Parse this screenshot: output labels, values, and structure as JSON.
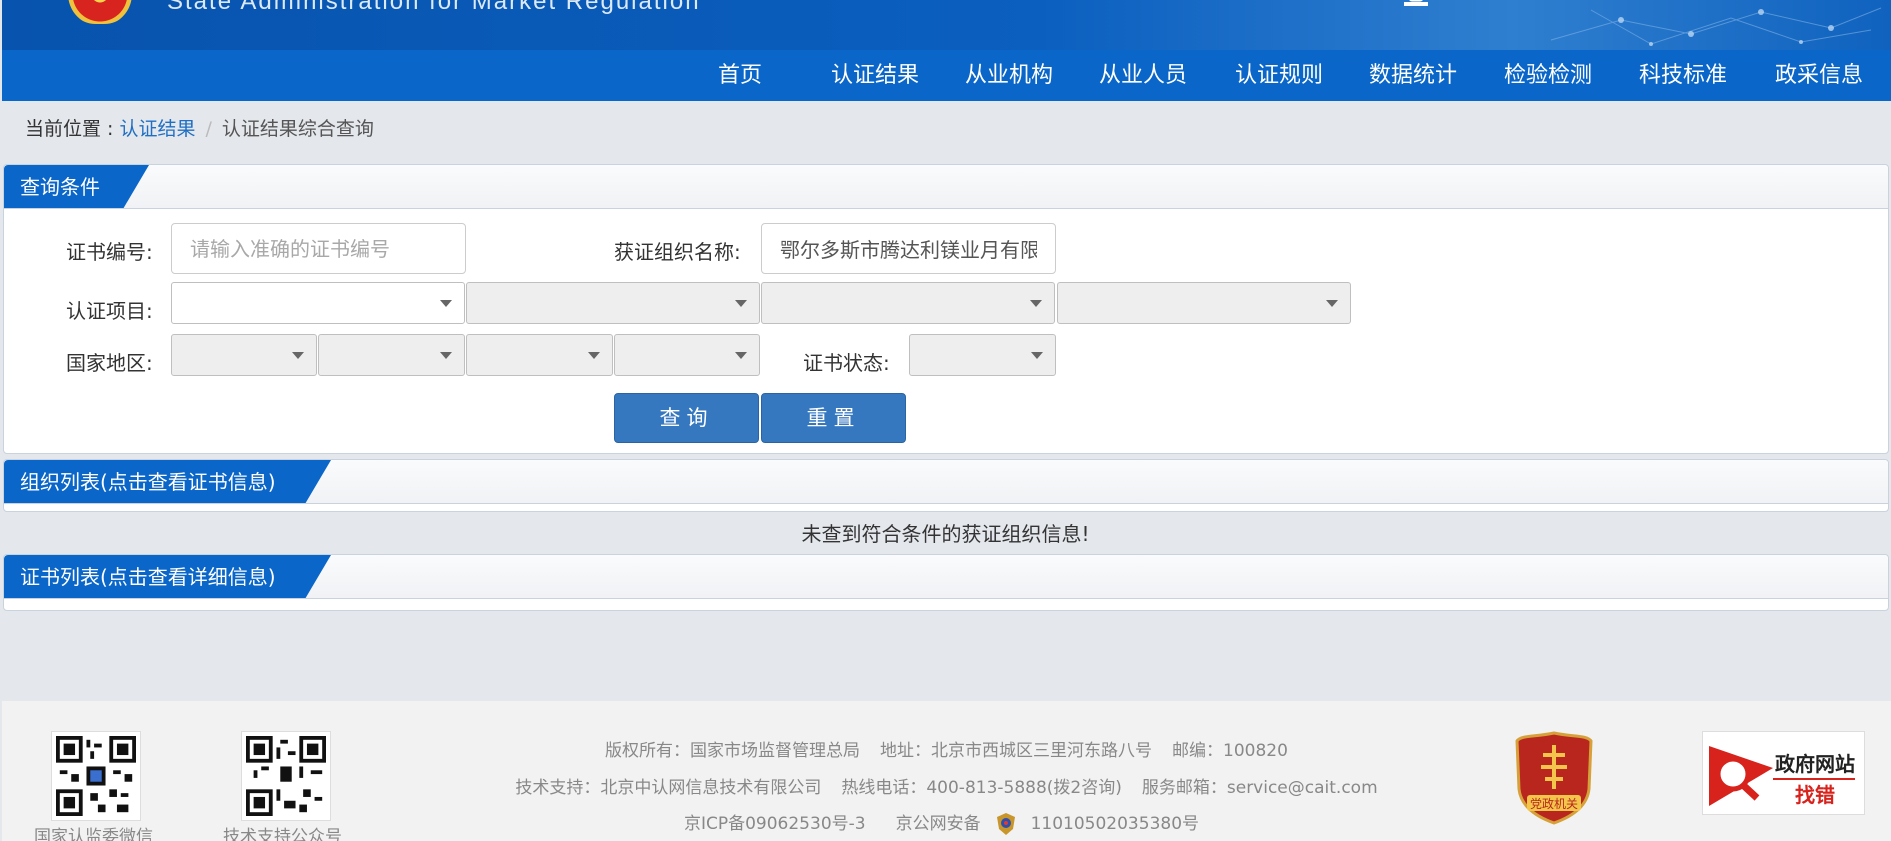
{
  "header": {
    "english_title": "State Administration  for  Market Regulation"
  },
  "nav": {
    "items": [
      "首页",
      "认证结果",
      "从业机构",
      "从业人员",
      "认证规则",
      "数据统计",
      "检验检测",
      "科技标准",
      "政采信息"
    ]
  },
  "breadcrumb": {
    "prefix": "当前位置 : ",
    "link": "认证结果",
    "separator": "/",
    "current": "认证结果综合查询"
  },
  "query_panel": {
    "title": "查询条件",
    "cert_no_label": "证书编号:",
    "cert_no_placeholder": "请输入准确的证书编号",
    "org_name_label": "获证组织名称:",
    "org_name_value": "鄂尔多斯市腾达利镁业月有限公司",
    "cert_project_label": "认证项目:",
    "region_label": "国家地区:",
    "status_label": "证书状态:",
    "query_button": "查询",
    "reset_button": "重置"
  },
  "org_panel": {
    "title": "组织列表(点击查看证书信息)",
    "empty_message": "未查到符合条件的获证组织信息!"
  },
  "cert_panel": {
    "title": "证书列表(点击查看详细信息)"
  },
  "footer": {
    "qr1_caption": "国家认监委微信",
    "qr2_caption": "技术支持公众号",
    "copyright": "版权所有：国家市场监督管理总局",
    "address": "地址：北京市西城区三里河东路八号",
    "postcode": "邮编：100820",
    "tech_support": "技术支持：北京中认网信息技术有限公司",
    "hotline": "热线电话：400-813-5888(拨2咨询)",
    "email": "服务邮箱：service@cait.com",
    "icp": "京ICP备09062530号-3",
    "police_prefix": "京公网安备",
    "police_no": "11010502035380号",
    "party_badge_text": "党政机关",
    "gov_site_line1": "政府网站",
    "gov_site_line2": "找错"
  },
  "colors": {
    "brand_blue": "#0a66c8",
    "button_blue": "#3578c0",
    "link_blue": "#1f6fc4"
  }
}
